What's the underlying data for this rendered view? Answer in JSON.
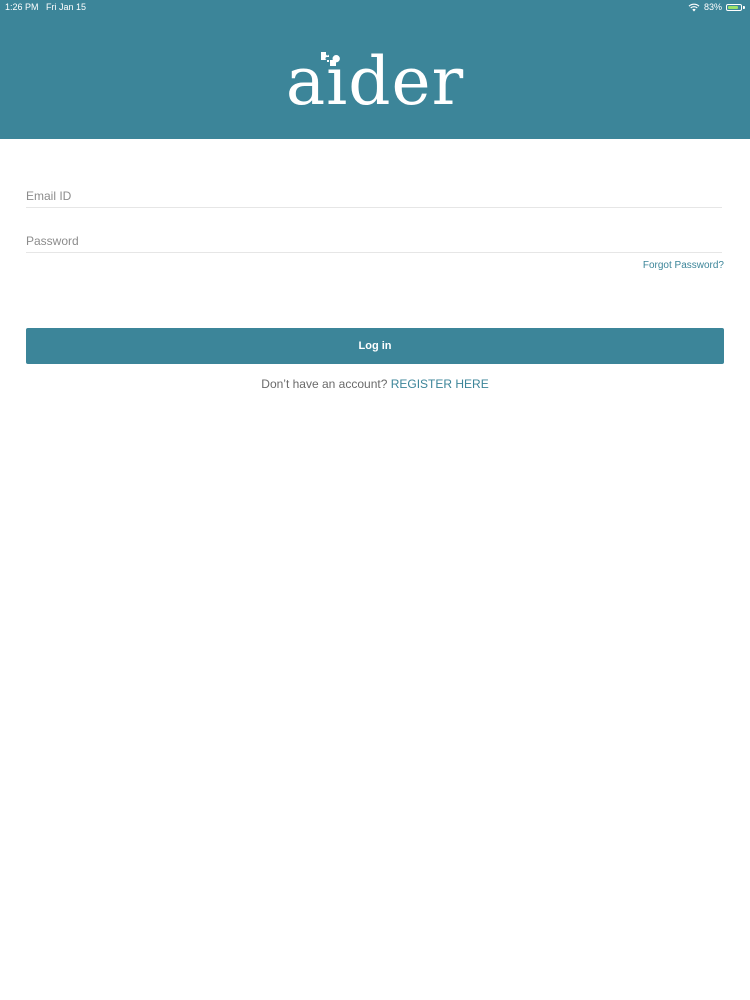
{
  "status_bar": {
    "time": "1:26 PM",
    "date": "Fri Jan 15",
    "battery_percent": "83%",
    "battery_level": 0.83,
    "wifi_icon": "wifi-icon",
    "battery_icon": "battery-charging-icon"
  },
  "header": {
    "logo_text": "aider",
    "logo_icon": "puzzle-mark-icon"
  },
  "form": {
    "email_placeholder": "Email ID",
    "email_value": "",
    "password_placeholder": "Password",
    "password_value": "",
    "forgot_password_label": "Forgot Password?",
    "login_label": "Log in"
  },
  "register": {
    "prompt": "Don’t have an account? ",
    "link_label": "REGISTER HERE"
  },
  "colors": {
    "brand": "#3c8599",
    "background": "#ffffff",
    "divider": "#e6e6e6",
    "muted_text": "#6a6a6a"
  }
}
